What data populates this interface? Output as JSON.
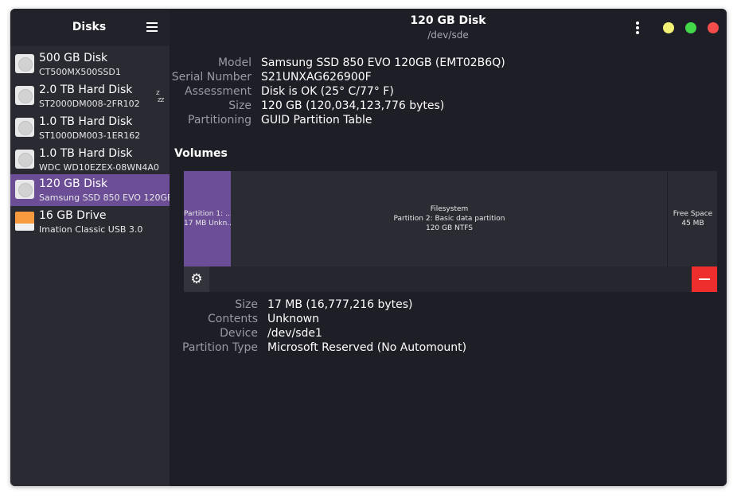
{
  "sidebar": {
    "title": "Disks",
    "menu_icon": "hamburger-icon",
    "disks": [
      {
        "name": "500 GB Disk",
        "model": "CT500MX500SSD1",
        "icon": "disk-icon"
      },
      {
        "name": "2.0 TB Hard Disk",
        "model": "ST2000DM008-2FR102",
        "icon": "disk-icon",
        "badge": "zzz"
      },
      {
        "name": "1.0 TB Hard Disk",
        "model": "ST1000DM003-1ER162",
        "icon": "disk-icon"
      },
      {
        "name": "1.0 TB Hard Disk",
        "model": "WDC WD10EZEX-08WN4A0",
        "icon": "disk-icon"
      },
      {
        "name": "120 GB Disk",
        "model": "Samsung SSD 850 EVO 120GB",
        "icon": "disk-icon",
        "selected": true
      },
      {
        "name": "16 GB Drive",
        "model": "Imation Classic USB 3.0",
        "icon": "usb-drive-icon"
      }
    ]
  },
  "header": {
    "title": "120 GB Disk",
    "subtitle": "/dev/sde",
    "colors": {
      "minimize": "#f4f276",
      "maximize": "#42d84a",
      "close": "#f54c4c"
    }
  },
  "disk_info": [
    {
      "label": "Model",
      "value": "Samsung SSD 850 EVO 120GB (EMT02B6Q)"
    },
    {
      "label": "Serial Number",
      "value": "S21UNXAG626900F"
    },
    {
      "label": "Assessment",
      "value": "Disk is OK (25° C/77° F)"
    },
    {
      "label": "Size",
      "value": "120 GB (120,034,123,776 bytes)"
    },
    {
      "label": "Partitioning",
      "value": "GUID Partition Table"
    }
  ],
  "volumes": {
    "heading": "Volumes",
    "segments": [
      {
        "lines": [
          "Partition 1: ...",
          "17 MB Unkn..."
        ],
        "selected": true
      },
      {
        "lines": [
          "Filesystem",
          "Partition 2: Basic data partition",
          "120 GB NTFS"
        ]
      },
      {
        "lines": [
          "Free Space",
          "45 MB"
        ]
      }
    ]
  },
  "partition_info": [
    {
      "label": "Size",
      "value": "17 MB (16,777,216 bytes)"
    },
    {
      "label": "Contents",
      "value": "Unknown"
    },
    {
      "label": "Device",
      "value": "/dev/sde1"
    },
    {
      "label": "Partition Type",
      "value": "Microsoft Reserved (No Automount)"
    }
  ],
  "accent": "#6c4e96"
}
